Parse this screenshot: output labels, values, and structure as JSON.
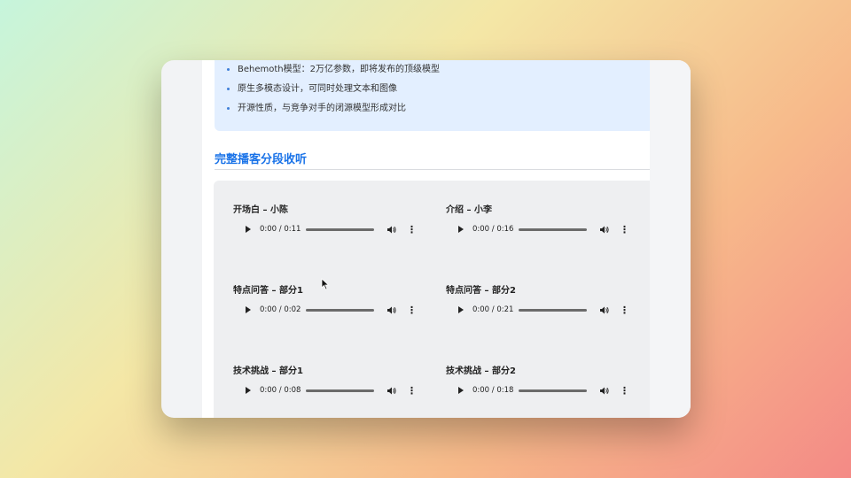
{
  "info_box": {
    "bullets": [
      "Behemoth模型：2万亿参数，即将发布的顶级模型",
      "原生多模态设计，可同时处理文本和图像",
      "开源性质，与竞争对手的闭源模型形成对比"
    ]
  },
  "section": {
    "title": "完整播客分段收听"
  },
  "segments": [
    {
      "title": "开场白 – 小陈",
      "time": "0:00 / 0:11"
    },
    {
      "title": "介绍 – 小李",
      "time": "0:00 / 0:16"
    },
    {
      "title": "特点问答 – 部分1",
      "time": "0:00 / 0:02"
    },
    {
      "title": "特点问答 – 部分2",
      "time": "0:00 / 0:21"
    },
    {
      "title": "技术挑战 – 部分1",
      "time": "0:00 / 0:08"
    },
    {
      "title": "技术挑战 – 部分2",
      "time": "0:00 / 0:18"
    }
  ],
  "icons": {
    "play": "play-icon",
    "volume": "volume-icon",
    "more": "more-options-icon",
    "cursor": "mouse-cursor-icon"
  }
}
